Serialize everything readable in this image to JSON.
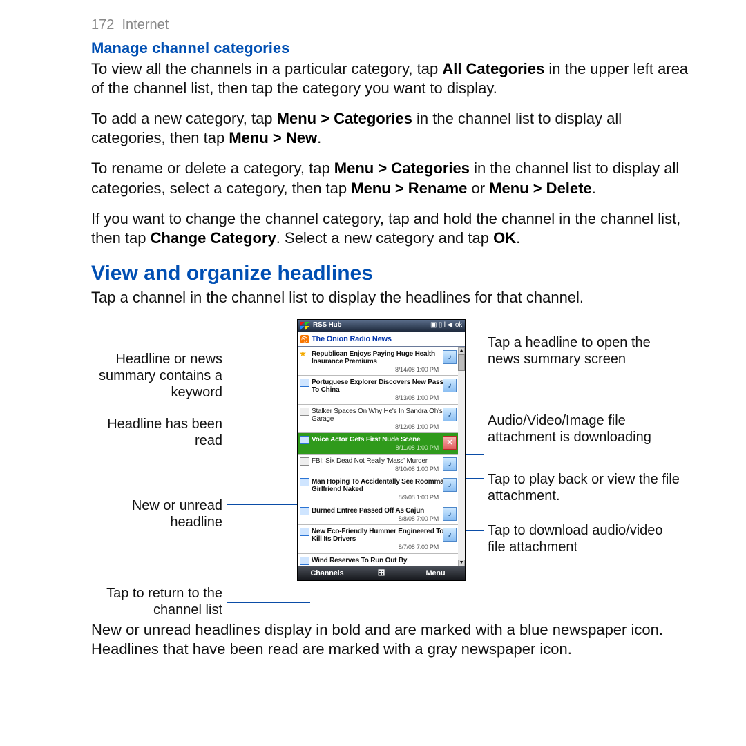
{
  "page_header": {
    "number": "172",
    "section": "Internet"
  },
  "sub1": {
    "title": "Manage channel categories"
  },
  "p1": {
    "a": "To view all the channels in a particular category, tap ",
    "b": "All Categories",
    "c": " in the upper left area of the channel list, then tap the category you want to display."
  },
  "p2": {
    "a": "To add a new category, tap ",
    "b": "Menu > Categories",
    "c": " in the channel list to display all categories, then tap ",
    "d": "Menu > New",
    "e": "."
  },
  "p3": {
    "a": "To rename or delete a category, tap ",
    "b": "Menu > Categories",
    "c": " in the channel list to display all categories, select a category, then tap ",
    "d": "Menu > Rename",
    "e": " or ",
    "f": "Menu > Delete",
    "g": "."
  },
  "p4": {
    "a": "If you want to change the channel category, tap and hold the channel in the channel list, then tap ",
    "b": "Change Category",
    "c": ". Select a new category and tap ",
    "d": "OK",
    "e": "."
  },
  "sec2": {
    "title": "View and organize headlines"
  },
  "p5": "Tap a channel in the channel list to display the headlines for that channel.",
  "callouts": {
    "l1": "Headline or news summary contains a keyword",
    "l2": "Headline has been read",
    "l3": "New or unread headline",
    "l4": "Tap to return to the channel list",
    "r1": "Tap a headline to open the news summary screen",
    "r2": "Audio/Video/Image file attachment is downloading",
    "r3": "Tap to play back or view the file attachment.",
    "r4": "Tap to download audio/video file attachment"
  },
  "phone": {
    "title": "RSS Hub",
    "ok": "ok",
    "channel": "The Onion Radio News",
    "softkeys": {
      "left": "Channels",
      "mid": "⊞",
      "right": "Menu"
    },
    "items": [
      {
        "title": "Republican Enjoys Paying Huge Health Insurance Premiums",
        "ts": "8/14/08 1:00 PM",
        "state": "kw",
        "att": "note"
      },
      {
        "title": "Portuguese Explorer Discovers New Passage To China",
        "ts": "8/13/08 1:00 PM",
        "state": "unread",
        "att": "note"
      },
      {
        "title": "Stalker Spaces On Why He's In Sandra Oh's Garage",
        "ts": "8/12/08 1:00 PM",
        "state": "read",
        "att": "note"
      },
      {
        "title": "Voice Actor Gets First Nude Scene",
        "ts": "8/11/08 1:00 PM",
        "state": "sel",
        "att": "dl"
      },
      {
        "title": "FBI: Six Dead Not Really 'Mass' Murder",
        "ts": "8/10/08 1:00 PM",
        "state": "read",
        "att": "note"
      },
      {
        "title": "Man Hoping To Accidentally See Roommate's Girlfriend Naked",
        "ts": "8/9/08 1:00 PM",
        "state": "unread",
        "att": "note"
      },
      {
        "title": "Burned Entree Passed Off As Cajun",
        "ts": "8/8/08 7:00 PM",
        "state": "unread",
        "att": "note"
      },
      {
        "title": "New Eco-Friendly Hummer Engineered To Kill Its Drivers",
        "ts": "8/7/08 7:00 PM",
        "state": "unread",
        "att": "note"
      },
      {
        "title": "Wind Reserves To Run Out By",
        "ts": "",
        "state": "unread",
        "att": ""
      }
    ]
  },
  "p6": "New or unread headlines display in bold and are marked with a blue newspaper icon. Headlines that have been read are marked with a gray newspaper icon."
}
